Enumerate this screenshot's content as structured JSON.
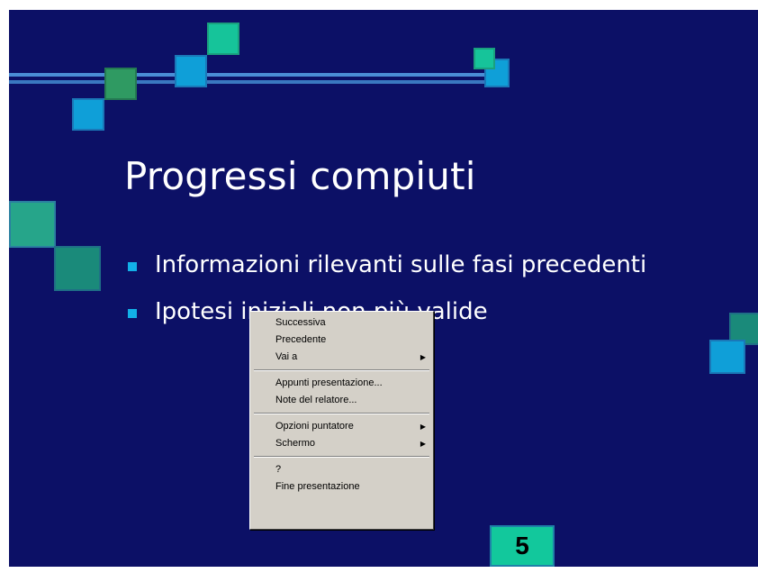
{
  "slide": {
    "title": "Progressi compiuti",
    "bullets": [
      "Informazioni rilevanti sulle fasi precedenti",
      "Ipotesi iniziali non più valide"
    ],
    "page_number": "5",
    "colors": {
      "background": "#0c1066",
      "accent_teal": "#16c49a",
      "accent_blue": "#0f9fd8",
      "bullet": "#12b0e8"
    }
  },
  "context_menu": {
    "items": [
      {
        "label": "Successiva"
      },
      {
        "label": "Precedente"
      },
      {
        "label": "Vai a",
        "submenu_icon": "submenu-arrow-icon"
      },
      {
        "label": "Appunti presentazione..."
      },
      {
        "label": "Note del relatore..."
      },
      {
        "label": "Opzioni puntatore",
        "submenu_icon": "submenu-arrow-icon"
      },
      {
        "label": "Schermo",
        "submenu_icon": "submenu-arrow-icon"
      },
      {
        "label": "?"
      },
      {
        "label": "Fine presentazione"
      }
    ]
  }
}
